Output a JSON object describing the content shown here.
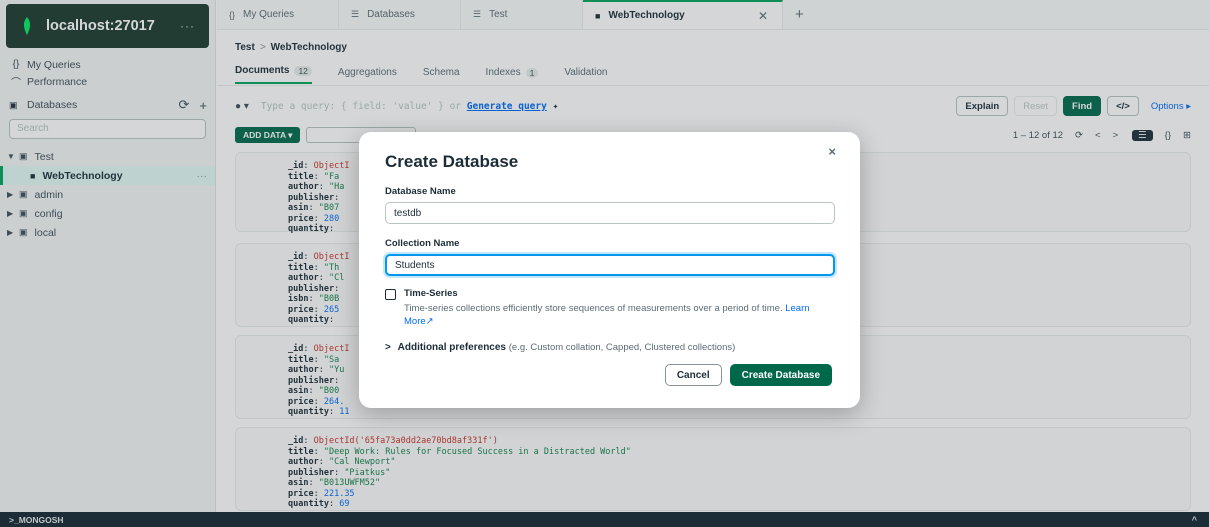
{
  "sidebar": {
    "connection_title": "localhost:27017",
    "more_label": "···",
    "nav": [
      {
        "icon": "{}",
        "label": "My Queries"
      },
      {
        "icon": "⌒",
        "label": "Performance"
      }
    ],
    "databases_label": "Databases",
    "search_placeholder": "Search",
    "tree": [
      {
        "label": "Test",
        "expanded": true
      },
      {
        "label": "WebTechnology",
        "active": true
      },
      {
        "label": "admin"
      },
      {
        "label": "config"
      },
      {
        "label": "local"
      }
    ]
  },
  "tabs": [
    {
      "icon": "{}",
      "label": "My Queries"
    },
    {
      "icon": "☰",
      "label": "Databases"
    },
    {
      "icon": "☰",
      "label": "Test"
    },
    {
      "icon": "■",
      "label": "WebTechnology",
      "active": true
    }
  ],
  "breadcrumb": {
    "db": "Test",
    "sep": ">",
    "collection": "WebTechnology"
  },
  "subtabs": [
    {
      "label": "Documents",
      "count": "12",
      "active": true
    },
    {
      "label": "Aggregations"
    },
    {
      "label": "Schema"
    },
    {
      "label": "Indexes",
      "count": "1"
    },
    {
      "label": "Validation"
    }
  ],
  "query": {
    "placeholder": "Type a query: { field: 'value' } or",
    "generate": "Generate query",
    "explain": "Explain",
    "reset": "Reset",
    "find": "Find",
    "code": "</>",
    "options": "Options ▸"
  },
  "actions": {
    "add_data": "ADD DATA ▾",
    "page_range": "1 – 12 of 12"
  },
  "documents": [
    {
      "lines": [
        {
          "k": "_id",
          "v": "ObjectI",
          "t": "id"
        },
        {
          "k": "title",
          "v": "\"Fa",
          "t": "s"
        },
        {
          "k": "author",
          "v": "\"Ha",
          "t": "s"
        },
        {
          "k": "publisher",
          "v": "",
          "t": "s"
        },
        {
          "k": "asin",
          "v": "\"B07",
          "t": "s"
        },
        {
          "k": "price",
          "v": "280",
          "t": "n"
        },
        {
          "k": "quantity",
          "v": "",
          "t": "n"
        }
      ]
    },
    {
      "lines": [
        {
          "k": "_id",
          "v": "ObjectI",
          "t": "id"
        },
        {
          "k": "title",
          "v": "\"Th",
          "t": "s"
        },
        {
          "k": "author",
          "v": "\"Cl",
          "t": "s"
        },
        {
          "k": "publisher",
          "v": "",
          "t": "s"
        },
        {
          "k": "isbn",
          "v": "\"B0B",
          "t": "s"
        },
        {
          "k": "price",
          "v": "265",
          "t": "n"
        },
        {
          "k": "quantity",
          "v": "",
          "t": "n"
        }
      ]
    },
    {
      "lines": [
        {
          "k": "_id",
          "v": "ObjectI",
          "t": "id"
        },
        {
          "k": "title",
          "v": "\"Sa",
          "t": "s"
        },
        {
          "k": "author",
          "v": "\"Yu",
          "t": "s"
        },
        {
          "k": "publisher",
          "v": "",
          "t": "s"
        },
        {
          "k": "asin",
          "v": "\"B00",
          "t": "s"
        },
        {
          "k": "price",
          "v": "264.",
          "t": "n"
        },
        {
          "k": "quantity",
          "v": "11",
          "t": "n"
        }
      ]
    },
    {
      "lines": [
        {
          "k": "_id",
          "v": "ObjectId('65fa73a0dd2ae70bd8af331f')",
          "t": "id"
        },
        {
          "k": "title",
          "v": "\"Deep Work: Rules for Focused Success in a Distracted World\"",
          "t": "s"
        },
        {
          "k": "author",
          "v": "\"Cal Newport\"",
          "t": "s"
        },
        {
          "k": "publisher",
          "v": "\"Piatkus\"",
          "t": "s"
        },
        {
          "k": "asin",
          "v": "\"B013UWFM52\"",
          "t": "s"
        },
        {
          "k": "price",
          "v": "221.35",
          "t": "n"
        },
        {
          "k": "quantity",
          "v": "69",
          "t": "n"
        }
      ]
    }
  ],
  "modal": {
    "title": "Create Database",
    "close": "×",
    "db_name_label": "Database Name",
    "db_name_value": "testdb",
    "coll_name_label": "Collection Name",
    "coll_name_value": "Students",
    "ts_label": "Time-Series",
    "ts_desc": "Time-series collections efficiently store sequences of measurements over a period of time.",
    "learn_more": "Learn More",
    "addl_chevron": ">",
    "addl_label": "Additional preferences",
    "addl_hint": "(e.g. Custom collation, Capped, Clustered collections)",
    "cancel": "Cancel",
    "create": "Create Database"
  },
  "bottom": {
    "label": ">_MONGOSH",
    "caret": "^"
  },
  "colors": {
    "accent": "#00684a",
    "brand_dark": "#1c3a2e",
    "link": "#016bf8",
    "focus": "#0498ec"
  }
}
